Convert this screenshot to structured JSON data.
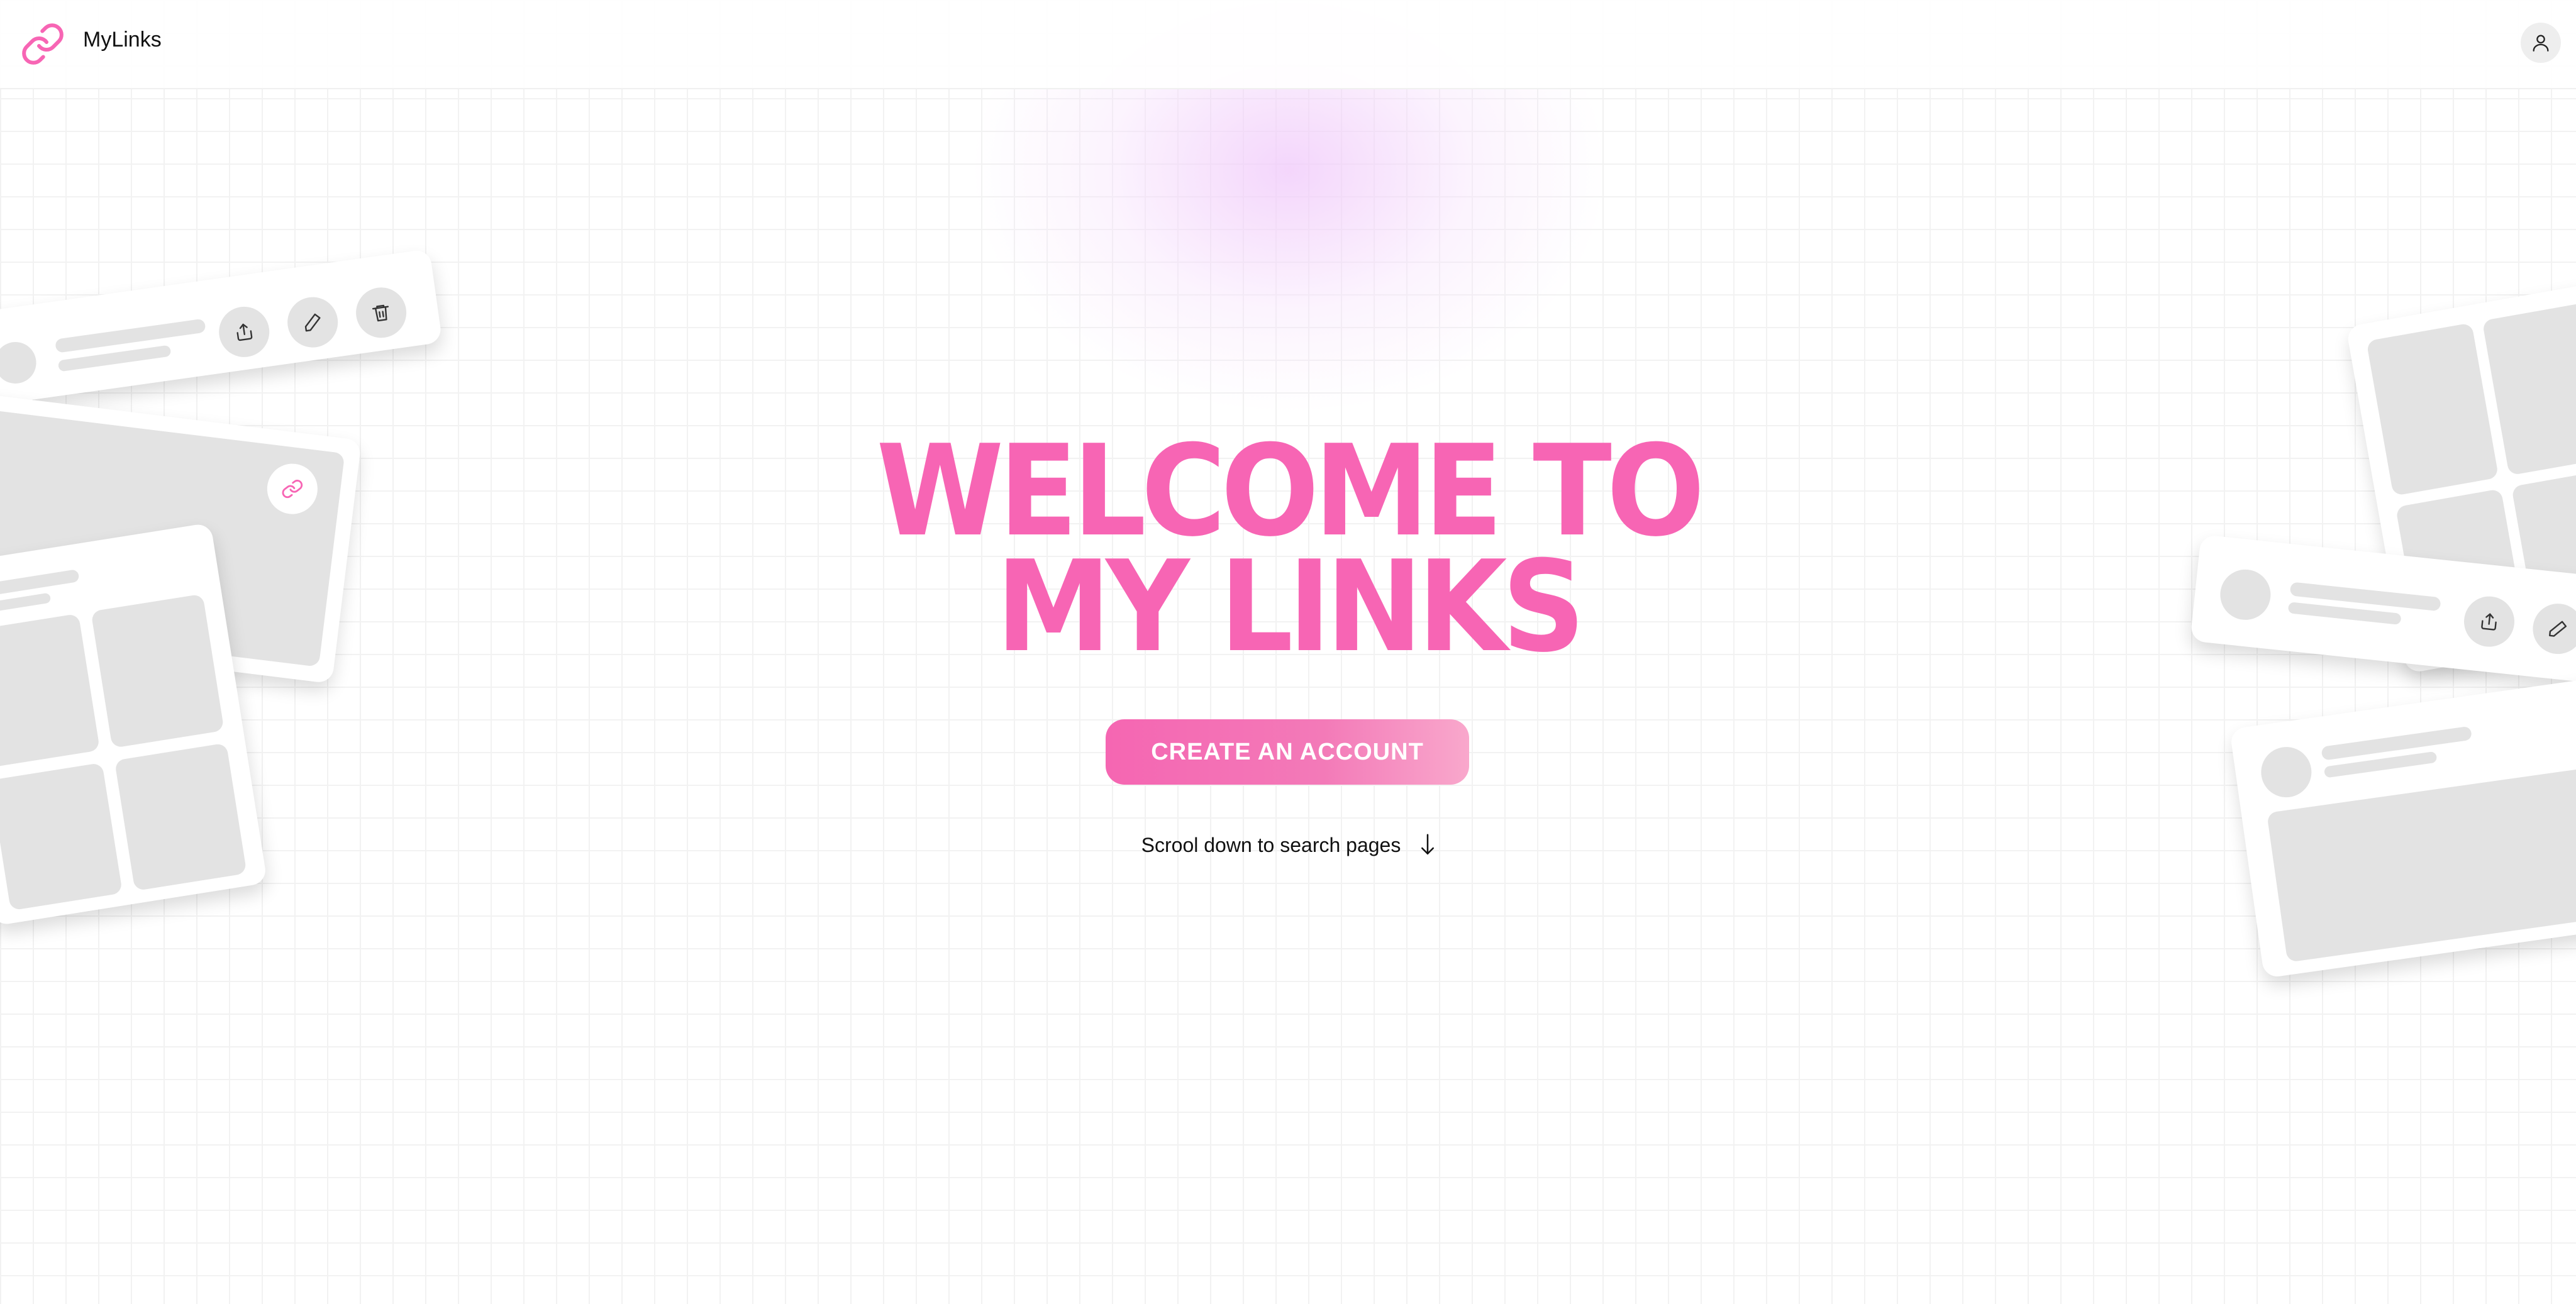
{
  "header": {
    "brand": "MyLinks",
    "logo_icon": "link-icon",
    "user_icon": "user-icon"
  },
  "hero": {
    "title_line1": "WELCOME TO",
    "title_line2": "MY LINKS",
    "cta_label": "CREATE AN ACCOUNT",
    "scroll_hint": "Scrool down to search pages",
    "scroll_icon": "arrow-down-icon"
  },
  "colors": {
    "accent": "#f765b4",
    "placeholder": "#e3e3e3",
    "background": "#ffffff"
  },
  "decor_icons": [
    "share-icon",
    "pencil-icon",
    "trash-icon",
    "link-icon"
  ]
}
